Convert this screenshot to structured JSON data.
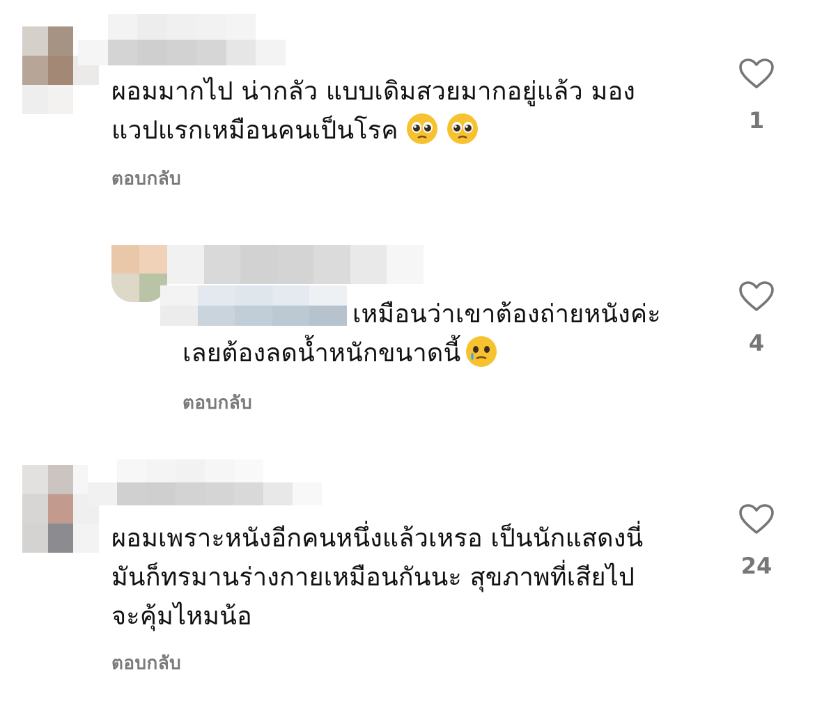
{
  "comments": [
    {
      "text": "ผอมมากไป น่ากลัว แบบเดิมสวยมากอยู่แล้ว มอง\nแวปแรกเหมือนคนเป็นโรค",
      "emojis": [
        "pleading-face",
        "pleading-face"
      ],
      "reply_label": "ตอบกลับ",
      "likes": "1"
    },
    {
      "text": "เหมือนว่าเขาต้องถ่ายหนังค่ะ\nเลยต้องลดน้ำหนักขนาดนี้",
      "emojis": [
        "face-holding-back-tears"
      ],
      "reply_label": "ตอบกลับ",
      "likes": "4"
    },
    {
      "text": "ผอมเพราะหนังอีกคนหนึ่งแล้วเหรอ เป็นนักแสดงนี่\nมันก็ทรมานร่างกายเหมือนกันนะ สุขภาพที่เสียไป\nจะคุ้มไหมน้อ",
      "emojis": [],
      "reply_label": "ตอบกลับ",
      "likes": "24"
    }
  ],
  "colors": {
    "text": "#111111",
    "muted": "#7a7a7a",
    "heart_stroke": "#767676"
  },
  "icons": [
    "heart-outline-icon",
    "pleading-face-emoji",
    "face-holding-back-tears-emoji"
  ]
}
